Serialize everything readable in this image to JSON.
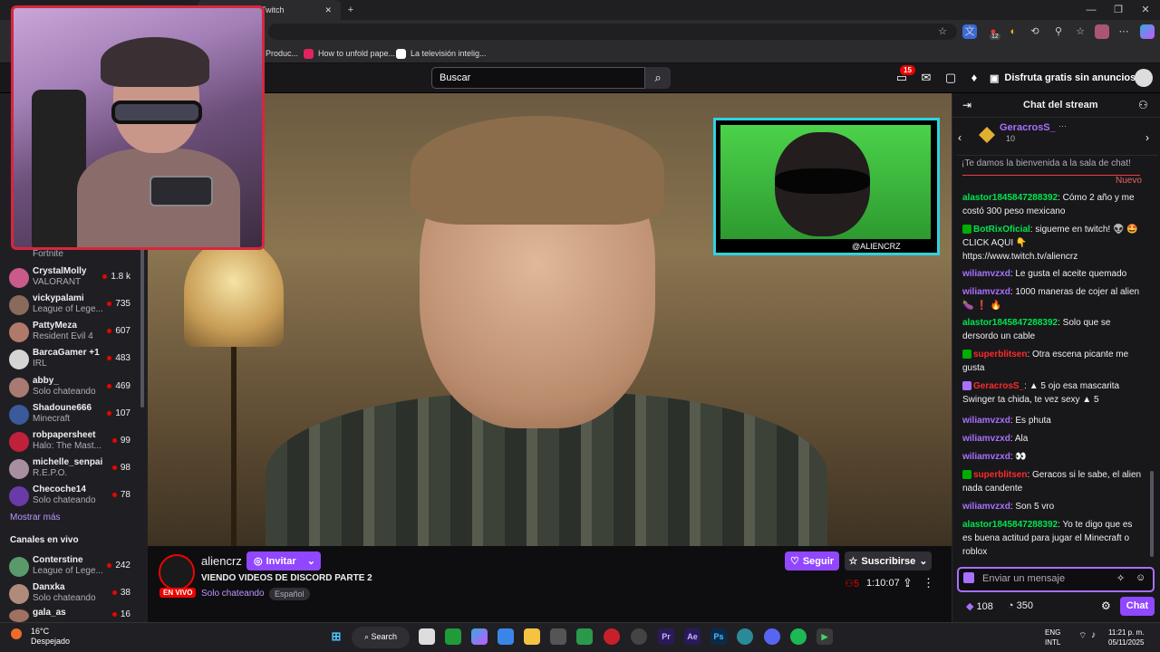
{
  "browser": {
    "tab_active_title": "Twitch",
    "bookmarks": [
      {
        "label": "Produc..."
      },
      {
        "label": "How to unfold pape..."
      },
      {
        "label": "La televisión intelig..."
      }
    ],
    "ext_badge": "12"
  },
  "topnav": {
    "search_placeholder": "Buscar",
    "notif_count": "15",
    "promo_label": "Disfruta gratis sin anuncios"
  },
  "sidebar": {
    "first_game": "Fortnite",
    "channels": [
      {
        "name": "CrystalMolly",
        "game": "VALORANT",
        "viewers": "1.8 k",
        "color": "#c85a8c"
      },
      {
        "name": "vickypalami",
        "game": "League of Lege...",
        "viewers": "735",
        "color": "#8a6a5a"
      },
      {
        "name": "PattyMeza",
        "game": "Resident Evil 4",
        "viewers": "607",
        "color": "#b07a6a"
      },
      {
        "name": "BarcaGamer +1",
        "game": "IRL",
        "viewers": "483",
        "color": "#d5d5d5"
      },
      {
        "name": "abby_",
        "game": "Solo chateando",
        "viewers": "469",
        "color": "#a87a72"
      },
      {
        "name": "Shadoune666",
        "game": "Minecraft",
        "viewers": "107",
        "color": "#3a5a9a"
      },
      {
        "name": "robpapersheet",
        "game": "Halo: The Mast...",
        "viewers": "99",
        "color": "#c0203a"
      },
      {
        "name": "michelle_senpai",
        "game": "R.E.P.O.",
        "viewers": "98",
        "color": "#a88fa0"
      },
      {
        "name": "Checoche14",
        "game": "Solo chateando",
        "viewers": "78",
        "color": "#6a3aa8"
      }
    ],
    "show_more": "Mostrar más",
    "live_header": "Canales en vivo",
    "live_channels": [
      {
        "name": "Conterstine",
        "game": "League of Lege...",
        "viewers": "242",
        "color": "#5a9a6a"
      },
      {
        "name": "Danxka",
        "game": "Solo chateando",
        "viewers": "38",
        "color": "#b08a7a"
      },
      {
        "name": "gala_as",
        "game": "",
        "viewers": "16",
        "color": "#a07060"
      }
    ]
  },
  "video": {
    "inset_label": "@ALIENCRZ"
  },
  "stream_info": {
    "channel_name": "aliencrz",
    "live_badge": "EN VIVO",
    "invite_label": "Invitar",
    "title": "VIENDO VIDEOS DE DISCORD PARTE 2",
    "category": "Solo chateando",
    "language": "Español",
    "follow_label": "Seguir",
    "subscribe_label": "Suscribirse",
    "viewers": "5",
    "uptime": "1:10:07"
  },
  "chat": {
    "title": "Chat del stream",
    "hype_user": "GeracrosS_",
    "hype_count": "10",
    "welcome": "¡Te damos la bienvenida a la sala de chat!",
    "new_label": "Nuevo",
    "messages": [
      {
        "user": "alastor1845847288392",
        "text": ": Cómo 2 año y me costó 300 peso mexicano",
        "cls": "u-green"
      },
      {
        "user": "BotRixOficial",
        "text": ": sigueme en twitch! 👽 🤩 CLICK AQUI 👇 https://www.twitch.tv/aliencrz",
        "cls": "u-green"
      },
      {
        "user": "wiliamvzxd",
        "text": ": Le gusta el aceite quemado",
        "cls": "u-purple"
      },
      {
        "user": "wiliamvzxd",
        "text": ": 1000 maneras de cojer al alien 🍆 ❗ 🔥",
        "cls": "u-purple"
      },
      {
        "user": "alastor1845847288392",
        "text": ": Solo que se dersordo un cable",
        "cls": "u-green"
      },
      {
        "user": "superblitsen",
        "text": ": Otra escena picante me gusta",
        "cls": "u-red"
      },
      {
        "user": "GeracrosS_",
        "text": ": ▲ 5 ojo esa mascarita Swinger ta chida, te vez sexy ▲ 5",
        "cls": "u-red"
      },
      {
        "user": "wiliamvzxd",
        "text": ": Es phuta",
        "cls": "u-purple"
      },
      {
        "user": "wiliamvzxd",
        "text": ": Ala",
        "cls": "u-purple"
      },
      {
        "user": "wiliamvzxd",
        "text": ": 👀",
        "cls": "u-purple"
      },
      {
        "user": "superblitsen",
        "text": ": Geracos si le sabe, el alien nada candente",
        "cls": "u-red"
      },
      {
        "user": "wiliamvzxd",
        "text": ": Son 5 vro",
        "cls": "u-purple"
      },
      {
        "user": "alastor1845847288392",
        "text": ": Yo te digo que es es buena actitud para jugar el Minecraft o roblox",
        "cls": "u-green"
      }
    ],
    "input_placeholder": "Enviar un mensaje",
    "bits": "108",
    "points": "350",
    "chat_button": "Chat"
  },
  "taskbar": {
    "temp": "16°C",
    "weather": "Despejado",
    "search": "Search",
    "lang1": "ENG",
    "lang2": "INTL",
    "time": "11:21 p. m.",
    "date": "05/11/2025"
  }
}
